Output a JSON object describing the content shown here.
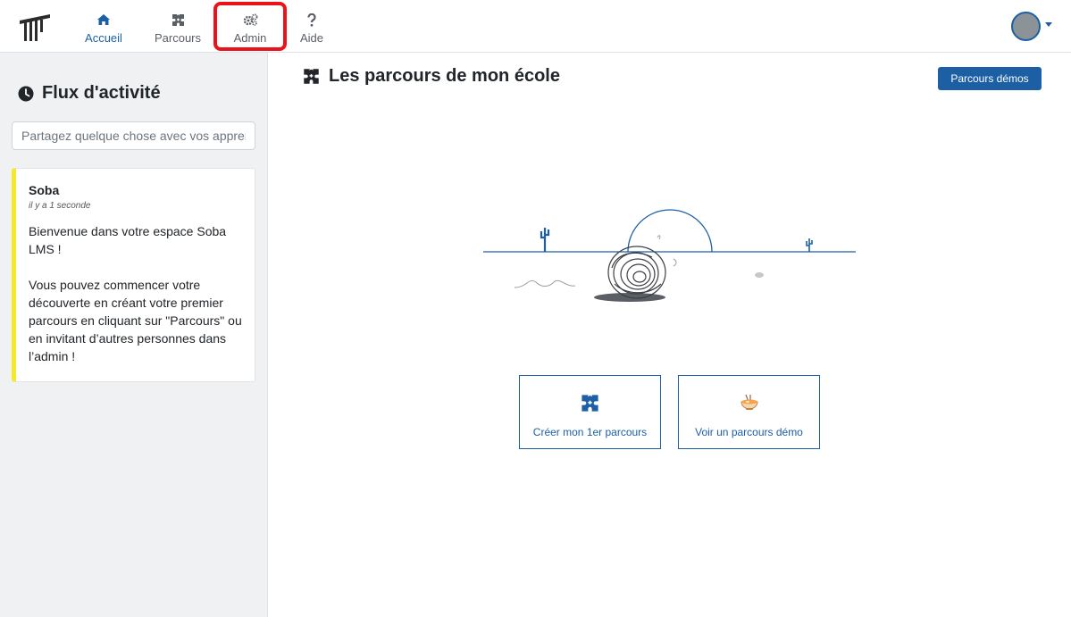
{
  "nav": {
    "items": [
      {
        "label": "Accueil",
        "icon": "home-icon",
        "active": true
      },
      {
        "label": "Parcours",
        "icon": "puzzle-icon",
        "active": false
      },
      {
        "label": "Admin",
        "icon": "gears-icon",
        "active": false
      },
      {
        "label": "Aide",
        "icon": "question-icon",
        "active": false
      }
    ]
  },
  "sidebar": {
    "title": "Flux d'activité",
    "share_placeholder": "Partagez quelque chose avec vos apprenants",
    "post": {
      "author": "Soba",
      "time": "il y a 1 seconde",
      "paragraph1": "Bienvenue dans votre espace Soba LMS !",
      "paragraph2": "Vous pouvez commencer votre découverte en créant votre premier parcours en cliquant sur \"Parcours\" ou en invitant d’autres personnes dans l’admin !"
    }
  },
  "main": {
    "title": "Les parcours de mon école",
    "demo_button": "Parcours démos",
    "actions": [
      {
        "label": "Créer mon 1er parcours",
        "icon": "puzzle-icon"
      },
      {
        "label": "Voir un parcours démo",
        "icon": "ramen-bowl-icon"
      }
    ]
  },
  "colors": {
    "accent": "#1c5fa5",
    "highlight": "#e8141b",
    "post_border": "#f5e92a"
  }
}
